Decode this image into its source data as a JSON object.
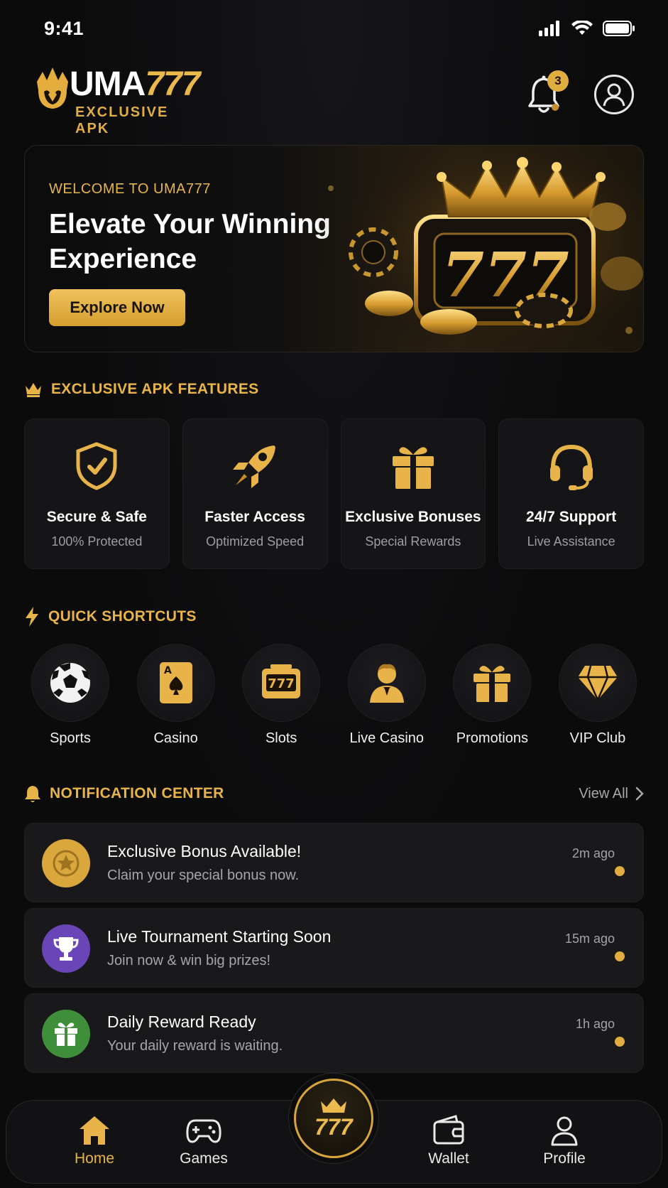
{
  "status_bar": {
    "time": "9:41"
  },
  "brand": {
    "name_part1": "UMA",
    "name_part2": "777",
    "subtitle": "EXCLUSIVE APK"
  },
  "header": {
    "notification_count": "3"
  },
  "hero": {
    "kicker": "WELCOME TO UMA777",
    "headline": "Elevate Your Winning Experience",
    "cta_label": "Explore Now",
    "art_text": "777"
  },
  "features": {
    "title": "EXCLUSIVE APK FEATURES",
    "items": [
      {
        "title": "Secure & Safe",
        "subtitle": "100% Protected",
        "icon": "shield-icon"
      },
      {
        "title": "Faster Access",
        "subtitle": "Optimized Speed",
        "icon": "rocket-icon"
      },
      {
        "title": "Exclusive Bonuses",
        "subtitle": "Special Rewards",
        "icon": "gift-icon"
      },
      {
        "title": "24/7 Support",
        "subtitle": "Live Assistance",
        "icon": "headset-icon"
      }
    ]
  },
  "shortcuts": {
    "title": "QUICK SHORTCUTS",
    "items": [
      {
        "label": "Sports",
        "icon": "soccer-ball-icon"
      },
      {
        "label": "Casino",
        "icon": "playing-card-icon"
      },
      {
        "label": "Slots",
        "icon": "slot-machine-icon"
      },
      {
        "label": "Live Casino",
        "icon": "dealer-icon"
      },
      {
        "label": "Promotions",
        "icon": "gift-icon"
      },
      {
        "label": "VIP Club",
        "icon": "diamond-icon"
      }
    ]
  },
  "notifications": {
    "title": "NOTIFICATION CENTER",
    "view_all": "View All",
    "items": [
      {
        "title": "Exclusive Bonus Available!",
        "subtitle": "Claim your special bonus now.",
        "time": "2m ago",
        "icon": "star-coin-icon",
        "color": "#d9a73c"
      },
      {
        "title": "Live Tournament Starting Soon",
        "subtitle": "Join now & win big prizes!",
        "time": "15m ago",
        "icon": "trophy-icon",
        "color": "#6a45b8"
      },
      {
        "title": "Daily Reward Ready",
        "subtitle": "Your daily reward is waiting.",
        "time": "1h ago",
        "icon": "gift-icon",
        "color": "#3f8f3a"
      }
    ]
  },
  "tabbar": {
    "items": [
      {
        "label": "Home",
        "icon": "home-icon",
        "active": true
      },
      {
        "label": "Games",
        "icon": "gamepad-icon",
        "active": false
      },
      {
        "label": "Wallet",
        "icon": "wallet-icon",
        "active": false
      },
      {
        "label": "Profile",
        "icon": "user-icon",
        "active": false
      }
    ],
    "center_label": "777"
  },
  "colors": {
    "accent": "#e8b449",
    "background": "#0b0b0c",
    "card": "#151517"
  }
}
